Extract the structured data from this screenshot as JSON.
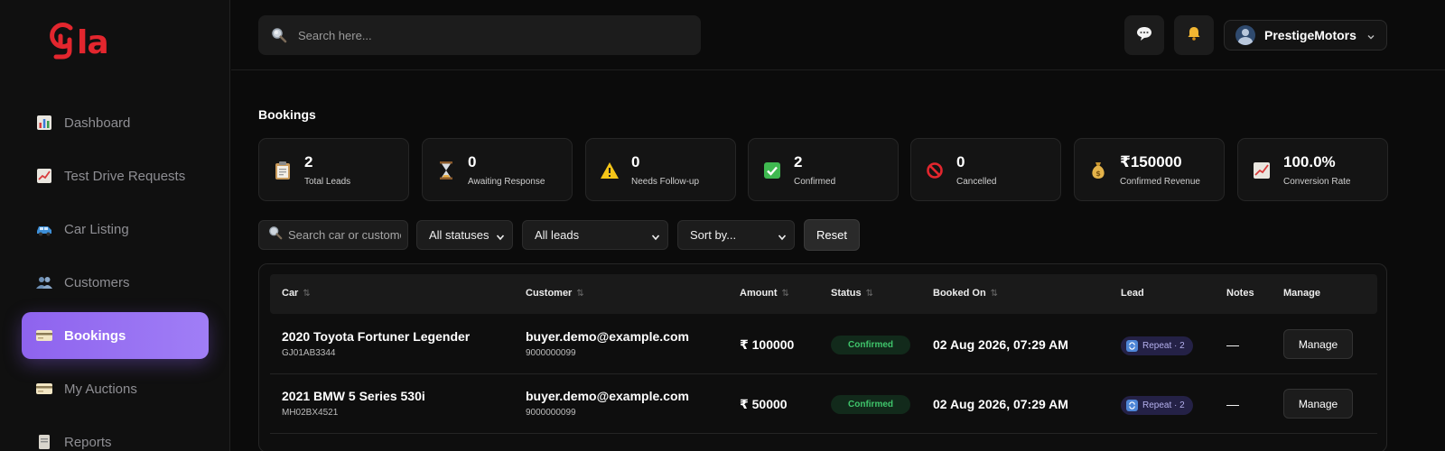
{
  "brand": {
    "logo_text": "la",
    "accent": "#e3262e"
  },
  "sidebar": {
    "items": [
      {
        "label": "Dashboard",
        "icon": "bar-chart-icon"
      },
      {
        "label": "Test Drive Requests",
        "icon": "trend-chart-icon"
      },
      {
        "label": "Car Listing",
        "icon": "car-icon"
      },
      {
        "label": "Customers",
        "icon": "users-icon"
      },
      {
        "label": "Bookings",
        "icon": "card-icon",
        "active": true
      },
      {
        "label": "My Auctions",
        "icon": "card-icon"
      },
      {
        "label": "Reports",
        "icon": "report-icon"
      }
    ]
  },
  "header": {
    "search_placeholder": "Search here...",
    "user_name": "PrestigeMotors"
  },
  "page": {
    "title": "Bookings"
  },
  "stats": [
    {
      "value": "2",
      "label": "Total Leads",
      "icon": "clipboard-icon"
    },
    {
      "value": "0",
      "label": "Awaiting Response",
      "icon": "hourglass-icon"
    },
    {
      "value": "0",
      "label": "Needs Follow-up",
      "icon": "warning-icon"
    },
    {
      "value": "2",
      "label": "Confirmed",
      "icon": "check-icon"
    },
    {
      "value": "0",
      "label": "Cancelled",
      "icon": "prohibited-icon"
    },
    {
      "value": "₹150000",
      "label": "Confirmed Revenue",
      "icon": "money-bag-icon"
    },
    {
      "value": "100.0%",
      "label": "Conversion Rate",
      "icon": "trend-chart-icon"
    }
  ],
  "filters": {
    "search_placeholder": "Search car or customer",
    "status_selected": "All statuses",
    "lead_selected": "All leads",
    "sort_selected": "Sort by...",
    "reset_label": "Reset"
  },
  "table": {
    "columns": {
      "car": "Car",
      "customer": "Customer",
      "amount": "Amount",
      "status": "Status",
      "booked_on": "Booked On",
      "lead": "Lead",
      "notes": "Notes",
      "manage": "Manage"
    },
    "sort_glyph": "⇅",
    "rows": [
      {
        "car": "2020 Toyota Fortuner Legender",
        "plate": "GJ01AB3344",
        "email": "buyer.demo@example.com",
        "phone": "9000000099",
        "amount": "₹ 100000",
        "status": "Confirmed",
        "booked_on": "02 Aug 2026, 07:29 AM",
        "lead": "Repeat · 2",
        "notes": "—",
        "action": "Manage"
      },
      {
        "car": "2021 BMW 5 Series 530i",
        "plate": "MH02BX4521",
        "email": "buyer.demo@example.com",
        "phone": "9000000099",
        "amount": "₹ 50000",
        "status": "Confirmed",
        "booked_on": "02 Aug 2026, 07:29 AM",
        "lead": "Repeat · 2",
        "notes": "—",
        "action": "Manage"
      }
    ]
  },
  "colors": {
    "active_nav": "#8e63ee",
    "status_confirmed": "#3fc56b",
    "lead_pill": "#b4b0ee"
  }
}
